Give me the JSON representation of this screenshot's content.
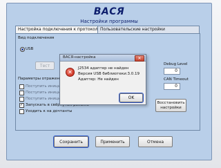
{
  "app": {
    "title": "ВАСЯ",
    "subtitle": "Настройки программы"
  },
  "tabs": [
    {
      "label": "Настройка подключения к протоколу",
      "active": true
    },
    {
      "label": "Пользовательские настройки",
      "active": false
    }
  ],
  "connection_group": {
    "label": "Вид подключения",
    "radio_usb": "USB",
    "test_button": "Тест"
  },
  "settings_group": {
    "label": "Параметры отражения",
    "checkboxes": [
      {
        "label": "Поступить инициализ",
        "checked": false
      },
      {
        "label": "Поступить инициали",
        "checked": false
      },
      {
        "label": "Поступить инициал",
        "checked": false
      },
      {
        "label": "Запускать в свёрнутом режиме",
        "checked": true
      },
      {
        "label": "Уходить к на дочтанты",
        "checked": false
      }
    ]
  },
  "right_fields": {
    "debug_label": "Debug Level",
    "debug_value": "0",
    "can_timeout_label": "CAN Timeout",
    "can_timeout_value": "0",
    "restore_button": "Восстановить настройки"
  },
  "dialog": {
    "title": "ВАСЯ-настройка",
    "close_glyph": "✕",
    "lines": [
      "J2534 адаптер не найден",
      "Версия USB библиотеки:3.0.19",
      "Адаптер: Не найден"
    ],
    "ok_button": "OK",
    "error_glyph": "✕"
  },
  "footer": {
    "save": "Сохранить",
    "apply": "Применить",
    "cancel": "Отмена"
  },
  "colors": {
    "window_bg": "#b9cfe9",
    "title_blue": "#0e1f6d",
    "button_outline_blue": "#2f58c9",
    "error_red": "#c42212"
  }
}
